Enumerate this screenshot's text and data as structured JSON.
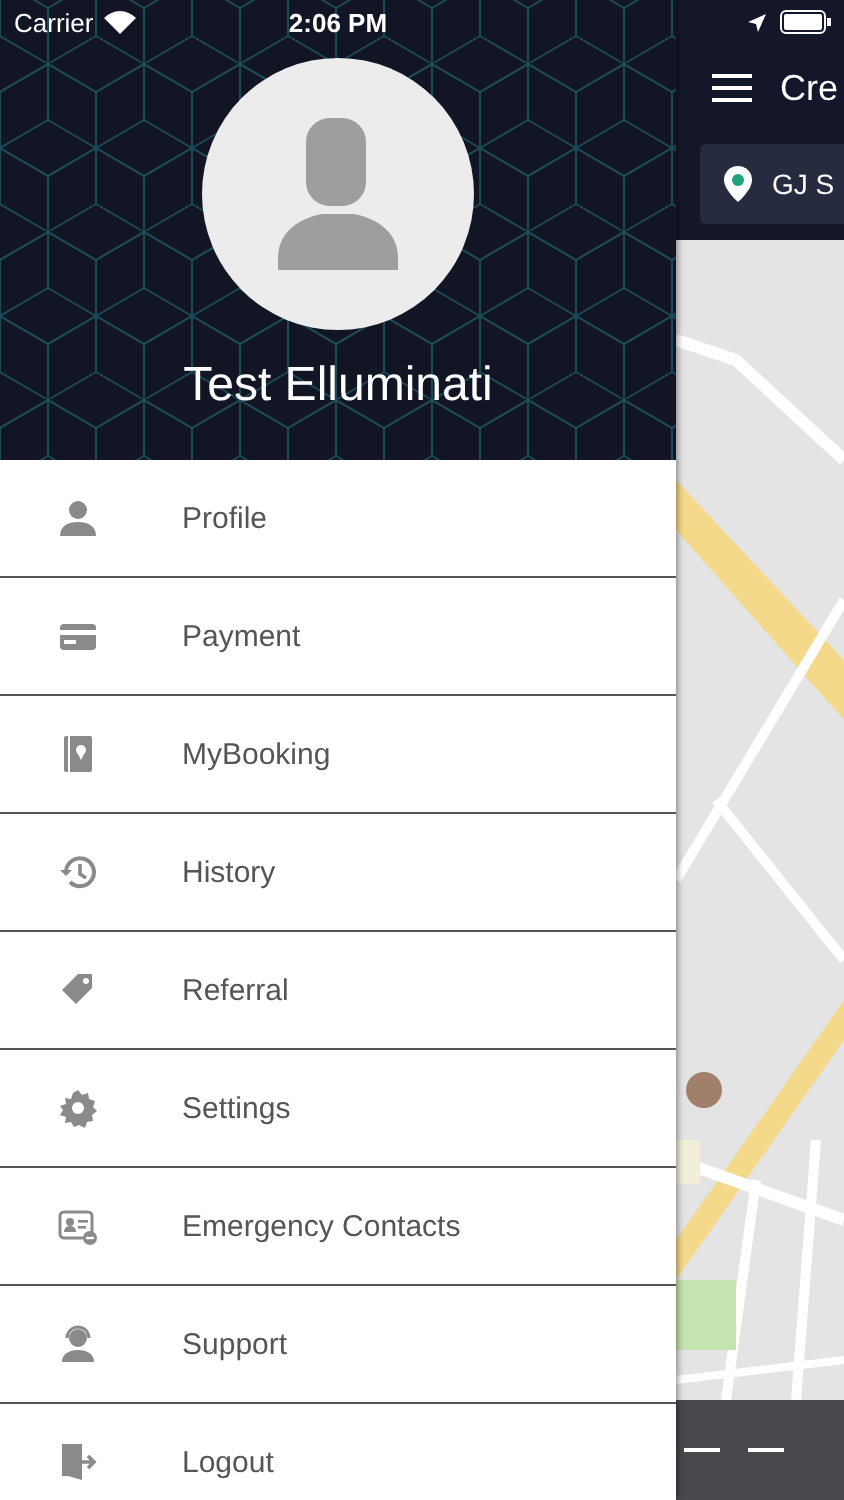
{
  "status_bar": {
    "carrier": "Carrier",
    "time": "2:06 PM"
  },
  "drawer": {
    "user_name": "Test Elluminati",
    "items": [
      {
        "label": "Profile"
      },
      {
        "label": "Payment"
      },
      {
        "label": "MyBooking"
      },
      {
        "label": "History"
      },
      {
        "label": "Referral"
      },
      {
        "label": "Settings"
      },
      {
        "label": "Emergency Contacts"
      },
      {
        "label": "Support"
      },
      {
        "label": "Logout"
      }
    ]
  },
  "main": {
    "title": "Cre",
    "location_field": {
      "value": "GJ S"
    }
  }
}
